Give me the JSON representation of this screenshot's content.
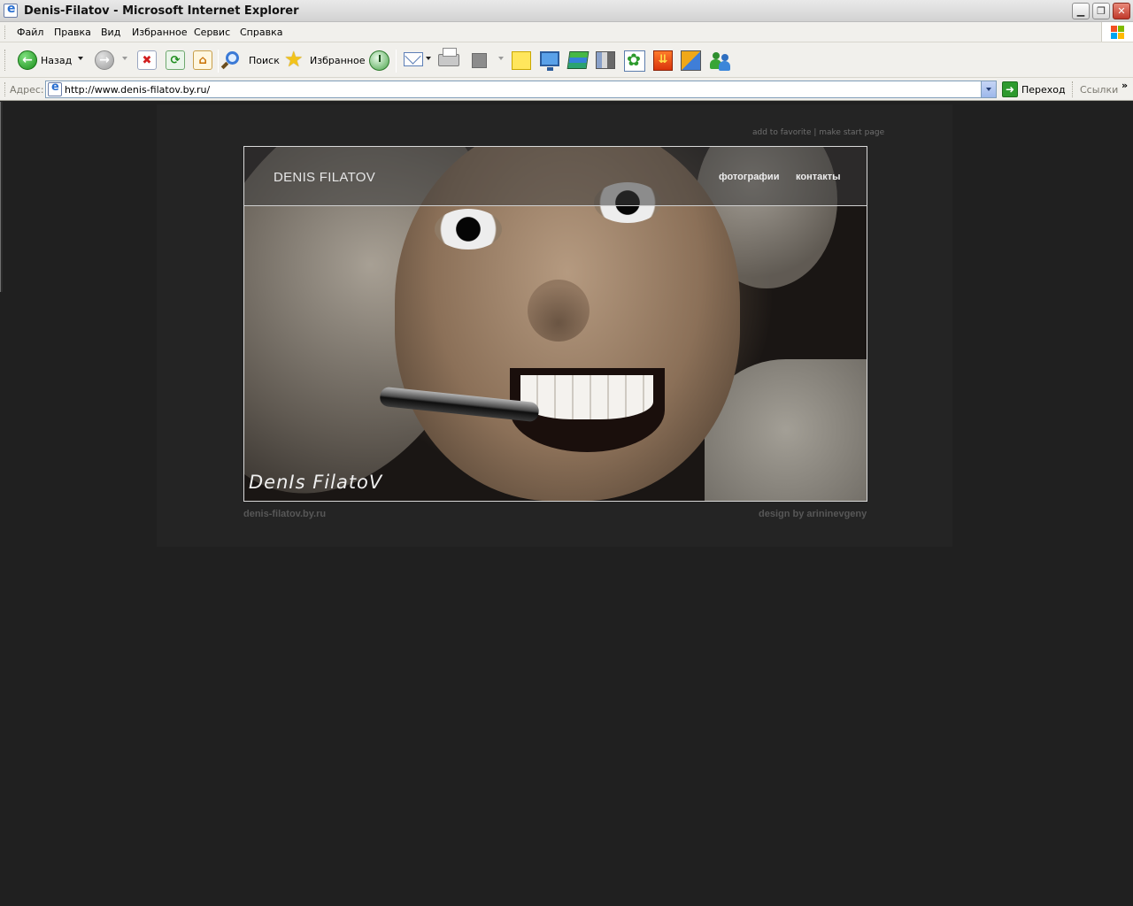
{
  "window": {
    "title": "Denis-Filatov - Microsoft Internet Explorer",
    "minimize_glyph": "▁",
    "maximize_glyph": "❐",
    "close_glyph": "✕"
  },
  "menu": {
    "items": [
      "Файл",
      "Правка",
      "Вид",
      "Избранное",
      "Сервис",
      "Справка"
    ]
  },
  "toolbar": {
    "back_label": "Назад",
    "back_glyph": "←",
    "forward_glyph": "→",
    "stop_glyph": "✖",
    "refresh_glyph": "⟳",
    "home_glyph": "⌂",
    "search_label": "Поиск",
    "favorites_label": "Избранное",
    "favorites_glyph": "★",
    "download_glyph": "⇊"
  },
  "address": {
    "label": "Адрес:",
    "url": "http://www.denis-filatov.by.ru/",
    "go_glyph": "➜",
    "go_label": "Переход",
    "links_label": "Ссылки",
    "links_chevron": "»"
  },
  "page": {
    "top_links": {
      "favorite": "add to favorite",
      "separator": " | ",
      "start_page": "make start page"
    },
    "brand": "DENIS FILATOV",
    "nav": {
      "photos": "фотографии",
      "contacts": "контакты"
    },
    "signature": "DenIs  FilatoV",
    "footer_left": "denis-filatov.by.ru",
    "footer_right": "design by arininevgeny"
  },
  "colors": {
    "page_background": "#202020",
    "panel_background": "#242424",
    "footer_text": "#575757"
  }
}
